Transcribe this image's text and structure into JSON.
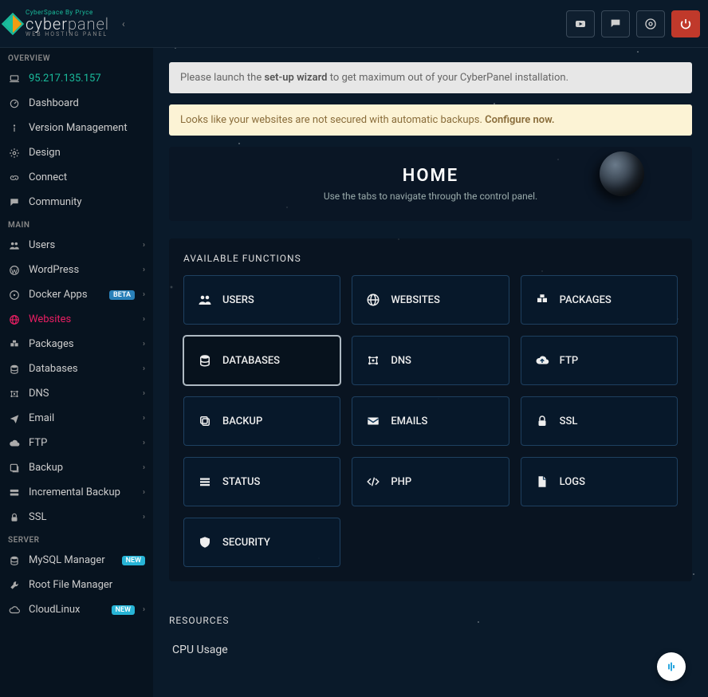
{
  "brand": {
    "tagline": "CyberSpace By Pryce",
    "name_a": "cyber",
    "name_b": "panel",
    "sub": "WEB HOSTING PANEL"
  },
  "topbar": {
    "youtube": "YouTube",
    "chat": "Chat",
    "help": "Help",
    "power": "Power"
  },
  "sidebar": {
    "sections": [
      {
        "title": "OVERVIEW",
        "items": [
          {
            "icon": "laptop",
            "label": "95.217.135.157",
            "class": "ip"
          },
          {
            "icon": "gauge",
            "label": "Dashboard"
          },
          {
            "icon": "info",
            "label": "Version Management"
          },
          {
            "icon": "gear",
            "label": "Design"
          },
          {
            "icon": "link",
            "label": "Connect"
          },
          {
            "icon": "comment",
            "label": "Community"
          }
        ]
      },
      {
        "title": "MAIN",
        "items": [
          {
            "icon": "users",
            "label": "Users",
            "chev": true
          },
          {
            "icon": "wordpress",
            "label": "WordPress",
            "chev": true
          },
          {
            "icon": "docker",
            "label": "Docker Apps",
            "chev": true,
            "badge": "BETA",
            "badgeClass": "beta"
          },
          {
            "icon": "globe",
            "label": "Websites",
            "chev": true,
            "active": true
          },
          {
            "icon": "packages",
            "label": "Packages",
            "chev": true
          },
          {
            "icon": "database",
            "label": "Databases",
            "chev": true
          },
          {
            "icon": "dns",
            "label": "DNS",
            "chev": true
          },
          {
            "icon": "send",
            "label": "Email",
            "chev": true
          },
          {
            "icon": "cloud",
            "label": "FTP",
            "chev": true
          },
          {
            "icon": "backup",
            "label": "Backup",
            "chev": true
          },
          {
            "icon": "inc",
            "label": "Incremental Backup",
            "chev": true
          },
          {
            "icon": "lock",
            "label": "SSL",
            "chev": true
          }
        ]
      },
      {
        "title": "SERVER",
        "items": [
          {
            "icon": "database",
            "label": "MySQL Manager",
            "badge": "NEW",
            "badgeClass": "new"
          },
          {
            "icon": "wrench",
            "label": "Root File Manager"
          },
          {
            "icon": "cloud2",
            "label": "CloudLinux",
            "chev": true,
            "badge": "NEW",
            "badgeClass": "new"
          }
        ]
      }
    ]
  },
  "alerts": {
    "setup_pre": "Please launch the ",
    "setup_strong": "set-up wizard",
    "setup_post": " to get maximum out of your CyberPanel installation.",
    "backup_pre": "Looks like your websites are not secured with automatic backups. ",
    "backup_strong": "Configure now."
  },
  "home": {
    "title": "HOME",
    "subtitle": "Use the tabs to navigate through the control panel."
  },
  "functions": {
    "title": "AVAILABLE FUNCTIONS",
    "cards": [
      {
        "icon": "users",
        "label": "USERS"
      },
      {
        "icon": "globe",
        "label": "WEBSITES"
      },
      {
        "icon": "packages",
        "label": "PACKAGES"
      },
      {
        "icon": "database",
        "label": "DATABASES",
        "active": true
      },
      {
        "icon": "dns",
        "label": "DNS"
      },
      {
        "icon": "cloudup",
        "label": "FTP"
      },
      {
        "icon": "copy",
        "label": "BACKUP"
      },
      {
        "icon": "mail",
        "label": "EMAILS"
      },
      {
        "icon": "lock",
        "label": "SSL"
      },
      {
        "icon": "bars",
        "label": "STATUS"
      },
      {
        "icon": "code",
        "label": "PHP"
      },
      {
        "icon": "file",
        "label": "LOGS"
      },
      {
        "icon": "shield",
        "label": "SECURITY"
      }
    ]
  },
  "resources": {
    "title": "RESOURCES",
    "cpu_label": "CPU Usage"
  }
}
